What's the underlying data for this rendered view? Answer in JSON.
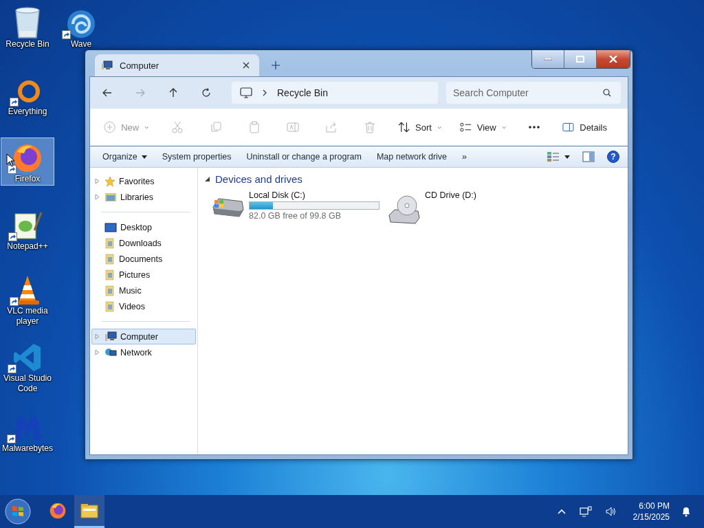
{
  "desktop_icons": [
    {
      "label": "Recycle Bin",
      "kind": "bin",
      "shortcut": false,
      "selected": false
    },
    {
      "label": "Wave",
      "kind": "wave",
      "shortcut": true,
      "selected": false
    },
    {
      "label": "Everything",
      "kind": "everything",
      "shortcut": true,
      "selected": false
    },
    {
      "label": "Firefox",
      "kind": "firefox",
      "shortcut": true,
      "selected": true
    },
    {
      "label": "Notepad++",
      "kind": "notepad",
      "shortcut": true,
      "selected": false
    },
    {
      "label": "VLC media player",
      "kind": "vlc",
      "shortcut": true,
      "selected": false
    },
    {
      "label": "Visual Studio Code",
      "kind": "vscode",
      "shortcut": true,
      "selected": false
    },
    {
      "label": "Malwarebytes",
      "kind": "malwarebytes",
      "shortcut": true,
      "selected": false
    }
  ],
  "window": {
    "tab": {
      "title": "Computer"
    },
    "address": {
      "path": "Recycle Bin"
    },
    "search": {
      "placeholder": "Search Computer"
    },
    "toolbar": [
      {
        "kind": "new",
        "label": "New",
        "disabled": true
      },
      {
        "kind": "cut",
        "disabled": true
      },
      {
        "kind": "copy",
        "disabled": true
      },
      {
        "kind": "paste",
        "disabled": true
      },
      {
        "kind": "rename",
        "disabled": true
      },
      {
        "kind": "share",
        "disabled": true
      },
      {
        "kind": "delete",
        "disabled": true
      },
      {
        "kind": "sort",
        "label": "Sort",
        "disabled": false
      },
      {
        "kind": "view",
        "label": "View",
        "disabled": false
      },
      {
        "kind": "more",
        "disabled": false
      }
    ],
    "details_button": {
      "label": "Details"
    },
    "command_bar": {
      "items": [
        {
          "label": "Organize",
          "dropdown": true
        },
        {
          "label": "System properties",
          "dropdown": false
        },
        {
          "label": "Uninstall or change a program",
          "dropdown": false
        },
        {
          "label": "Map network drive",
          "dropdown": false
        }
      ],
      "overflow": "»",
      "help": "?"
    },
    "nav_pane": [
      [
        {
          "label": "Favorites",
          "kind": "star",
          "expandable": true,
          "selected": false
        },
        {
          "label": "Libraries",
          "kind": "library",
          "expandable": true,
          "selected": false
        }
      ],
      [
        {
          "label": "Desktop",
          "kind": "desktop",
          "expandable": false,
          "selected": false
        },
        {
          "label": "Downloads",
          "kind": "folder",
          "expandable": false,
          "selected": false
        },
        {
          "label": "Documents",
          "kind": "folder",
          "expandable": false,
          "selected": false
        },
        {
          "label": "Pictures",
          "kind": "folder",
          "expandable": false,
          "selected": false
        },
        {
          "label": "Music",
          "kind": "folder",
          "expandable": false,
          "selected": false
        },
        {
          "label": "Videos",
          "kind": "folder",
          "expandable": false,
          "selected": false
        }
      ],
      [
        {
          "label": "Computer",
          "kind": "computer",
          "expandable": true,
          "selected": true
        },
        {
          "label": "Network",
          "kind": "network",
          "expandable": true,
          "selected": false
        }
      ]
    ],
    "section": {
      "title": "Devices and drives",
      "expanded": true
    },
    "drives": [
      {
        "name": "Local Disk (C:)",
        "kind": "hdd",
        "level": 0.18,
        "space": "82.0 GB free of 99.8 GB"
      },
      {
        "name": "CD Drive (D:)",
        "kind": "cd"
      }
    ]
  },
  "taskbar": {
    "apps": [
      {
        "kind": "firefox",
        "active": false
      },
      {
        "kind": "explorer",
        "active": true
      }
    ],
    "time": "6:00 PM",
    "date": "2/15/2025"
  }
}
